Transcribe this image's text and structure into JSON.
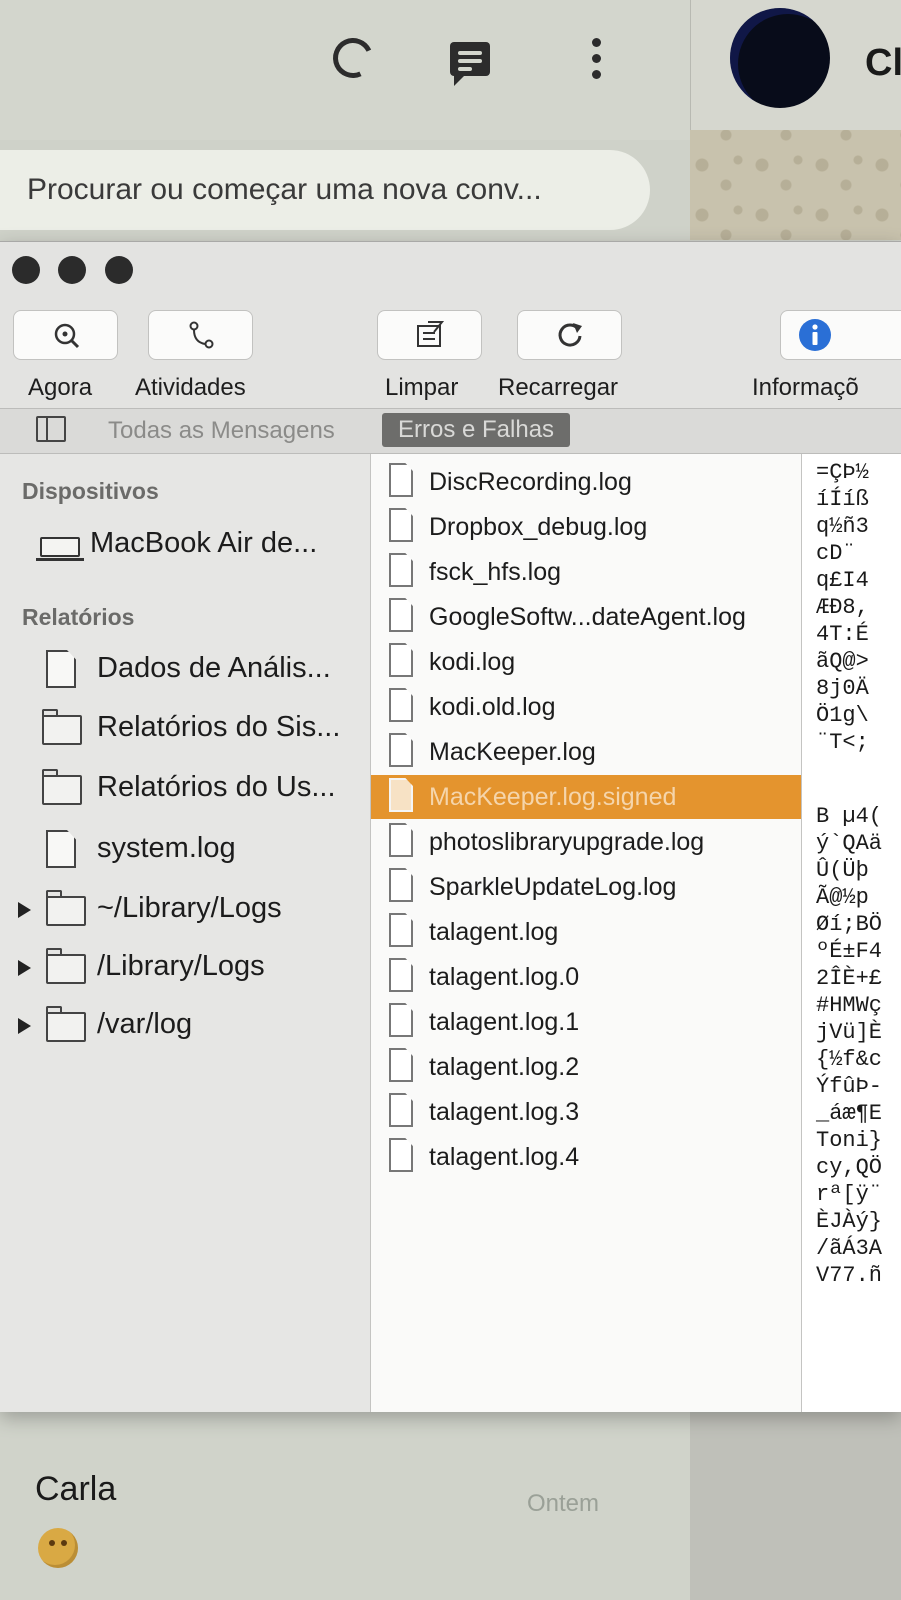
{
  "background_app": {
    "search_placeholder": "Procurar ou começar uma nova conv...",
    "chat_header_name": "Cl",
    "chat_list_item": {
      "name": "Carla",
      "date": "Ontem"
    }
  },
  "window": {
    "toolbar": {
      "now": "Agora",
      "activities": "Atividades",
      "clear": "Limpar",
      "reload": "Recarregar",
      "info": "Informaçõ"
    },
    "filter": {
      "all_messages": "Todas as Mensagens",
      "errors_faults": "Erros e Falhas"
    },
    "sidebar": {
      "devices_header": "Dispositivos",
      "device": "MacBook Air de...",
      "reports_header": "Relatórios",
      "items": [
        {
          "label": "Dados de Anális...",
          "icon": "document-icon"
        },
        {
          "label": "Relatórios do Sis...",
          "icon": "folder-icon"
        },
        {
          "label": "Relatórios do Us...",
          "icon": "folder-icon"
        },
        {
          "label": "system.log",
          "icon": "document-icon"
        },
        {
          "label": "~/Library/Logs",
          "icon": "folder-icon"
        },
        {
          "label": "/Library/Logs",
          "icon": "folder-icon"
        },
        {
          "label": "/var/log",
          "icon": "folder-icon"
        }
      ]
    },
    "files": [
      "DiscRecording.log",
      "Dropbox_debug.log",
      "fsck_hfs.log",
      "GoogleSoftw...dateAgent.log",
      "kodi.log",
      "kodi.old.log",
      "MacKeeper.log",
      "MacKeeper.log.signed",
      "photoslibraryupgrade.log",
      "SparkleUpdateLog.log",
      "talagent.log",
      "talagent.log.0",
      "talagent.log.1",
      "talagent.log.2",
      "talagent.log.3",
      "talagent.log.4"
    ],
    "selected_file": "MacKeeper.log.signed",
    "content_lines": [
      "=ÇÞ½",
      "íÍíß",
      "q½ñ3",
      "cD¨",
      "q£I4",
      "ÆÐ8,",
      "4T:É",
      "ãQ@>",
      "8j0Ä",
      "Ö1g\\",
      "¨T<;",
      "",
      "B µ4(",
      "ý`QAä",
      "Û(Üþ",
      "Ã@½p",
      "Øí;BÖ",
      "ºÉ±F4",
      "2ÎÈ+£",
      "#HMWç",
      "jVü]È",
      "{½f&c",
      "ÝfûÞ-",
      "_áæ¶E",
      "Toni}",
      "cy,QÖ",
      "rª[ÿ¨",
      "ÈJÀý}",
      "/ãÁ3A",
      "V77.ñ"
    ],
    "colors": {
      "selection": "#e4942e",
      "info_icon": "#2a6fd6"
    }
  }
}
